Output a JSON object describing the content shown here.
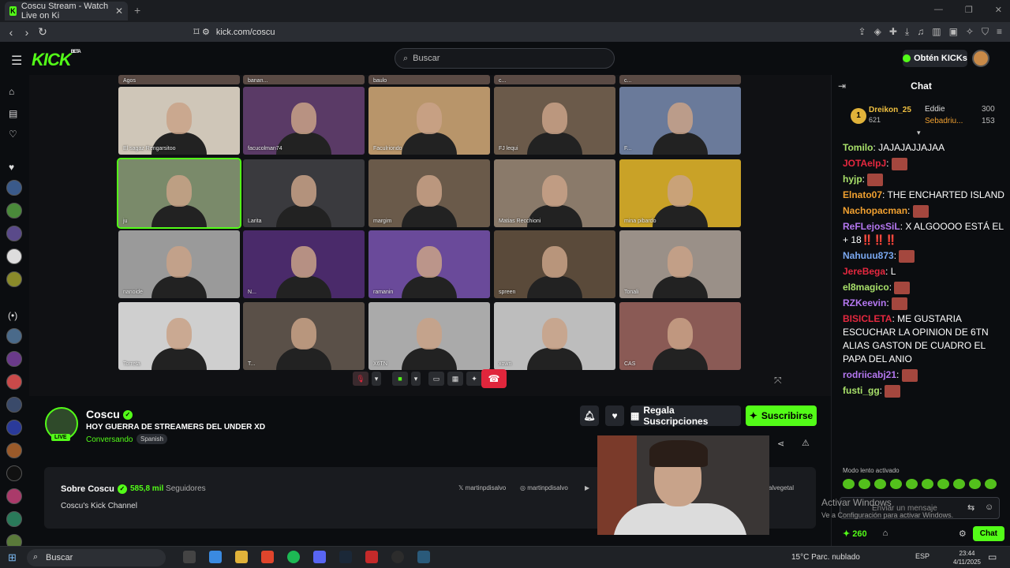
{
  "browser": {
    "tab_title": "Coscu Stream - Watch Live on Ki",
    "tab_close": "✕",
    "new_tab": "+",
    "url": "kick.com/coscu"
  },
  "header": {
    "logo": "KICK",
    "logo_tag": "BETA",
    "search_placeholder": "Buscar",
    "get_kicks": "Obtén KICKs"
  },
  "video": {
    "participants": [
      {
        "name": "El sagaz Rengarsitoo",
        "color": "#cfc6b8"
      },
      {
        "name": "facucolman74",
        "color": "#5a3a66"
      },
      {
        "name": "Faculriondo",
        "color": "#b8956a"
      },
      {
        "name": "FJ lequi",
        "color": "#6b5a4a"
      },
      {
        "name": "F...",
        "color": "#6a7a9a"
      },
      {
        "name": "ju",
        "color": "#7a8a6a"
      },
      {
        "name": "Larita",
        "color": "#3a3a3e"
      },
      {
        "name": "margim",
        "color": "#6a5a4a"
      },
      {
        "name": "Matias Recchioni",
        "color": "#8a7a6a"
      },
      {
        "name": "mina pibardo",
        "color": "#c9a227"
      },
      {
        "name": "nanoide",
        "color": "#9a9a9a"
      },
      {
        "name": "N...",
        "color": "#4a2a6a"
      },
      {
        "name": "ramanin",
        "color": "#6a4a9a"
      },
      {
        "name": "spreen",
        "color": "#5a4a3a"
      },
      {
        "name": "Tonali",
        "color": "#9a9088"
      },
      {
        "name": "Torreta",
        "color": "#cfcfcf"
      },
      {
        "name": "T...",
        "color": "#5a5048"
      },
      {
        "name": "X6TN",
        "color": "#aaaaaa"
      },
      {
        "name": "xown",
        "color": "#bdbdbd"
      },
      {
        "name": "CAS",
        "color": "#8a5a55"
      }
    ],
    "top_row_labels": [
      "Agos",
      "banan...",
      "baulo",
      "c...",
      "c..."
    ]
  },
  "channel": {
    "name": "Coscu",
    "verified_mark": "✓",
    "live": "LIVE",
    "title": "HOY GUERRA DE STREAMERS DEL UNDER XD",
    "category": "Conversando",
    "language": "Spanish",
    "gift_subs": "Regala Suscripciones",
    "subscribe": "Suscribirse"
  },
  "about": {
    "title": "Sobre Coscu",
    "followers_count": "585,8 mil",
    "followers_label": "Seguidores",
    "description": "Coscu's Kick Channel",
    "social_x": "martinpdisalvo",
    "social_ig": "martinpdisalvo",
    "social_other": "alvegetal"
  },
  "chat": {
    "title": "Chat",
    "pinned": {
      "rank": "1",
      "user1": "Dreikon_25",
      "user1_amt": "621",
      "user2": "Eddie",
      "user2_amt": "300",
      "user3": "Sebadriu...",
      "user3_amt": "153"
    },
    "messages": [
      {
        "user": "Tomilo",
        "color": "#a8e06a",
        "text": "JAJAJAJJAJAA",
        "emote": false
      },
      {
        "user": "JOTAelpJ",
        "color": "#e5283f",
        "text": "",
        "emote": true
      },
      {
        "user": "hyjp",
        "color": "#a8e06a",
        "text": "",
        "emote": true
      },
      {
        "user": "Elnato07",
        "color": "#f0a030",
        "text": "THE ENCHARTED ISLAND",
        "emote": false
      },
      {
        "user": "Nachopacman",
        "color": "#f0a030",
        "text": "",
        "emote": true
      },
      {
        "user": "ReFLejosSiL",
        "color": "#b477f0",
        "text": "X ALGOOOO ESTÁ EL + 18‼️‼️‼️",
        "emote": false
      },
      {
        "user": "Nahuuu873",
        "color": "#7aa8f0",
        "text": "",
        "emote": true
      },
      {
        "user": "JereBega",
        "color": "#e5283f",
        "text": "L",
        "emote": false
      },
      {
        "user": "el8magico",
        "color": "#a8e06a",
        "text": "",
        "emote": true
      },
      {
        "user": "RZKeevin",
        "color": "#b477f0",
        "text": "",
        "emote": true
      },
      {
        "user": "BISICLETA",
        "color": "#e5283f",
        "text": "ME GUSTARIA ESCUCHAR LA OPINION DE 6TN ALIAS GASTON DE CUADRO EL PAPA DEL ANIO",
        "emote": false
      },
      {
        "user": "rodriicabj21",
        "color": "#b477f0",
        "text": "",
        "emote": true
      },
      {
        "user": "fusti_gg",
        "color": "#a8e06a",
        "text": "",
        "emote": true
      }
    ],
    "slow_mode": "Modo lento activado",
    "input_placeholder": "Enviar un mensaje",
    "kicks_count": "260",
    "send_button": "Chat"
  },
  "windows": {
    "watermark1": "Activar Windows",
    "watermark2": "Ve a Configuración para activar Windows.",
    "taskbar_search": "Buscar",
    "weather": "15°C  Parc. nublado",
    "lang": "ESP",
    "time": "23:44",
    "date": "4/11/2025"
  }
}
